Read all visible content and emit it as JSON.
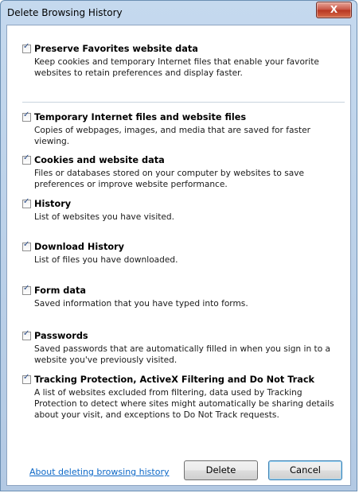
{
  "window": {
    "title": "Delete Browsing History",
    "close_label": "X"
  },
  "options": [
    {
      "title": "Preserve Favorites website data",
      "checked": true,
      "description": "Keep cookies and temporary Internet files that enable your favorite websites to retain preferences and display faster."
    },
    {
      "title": "Temporary Internet files and website files",
      "checked": true,
      "description": "Copies of webpages, images, and media that are saved for faster viewing."
    },
    {
      "title": "Cookies and website data",
      "checked": true,
      "description": "Files or databases stored on your computer by websites to save preferences or improve website performance."
    },
    {
      "title": "History",
      "checked": true,
      "description": "List of websites you have visited."
    },
    {
      "title": "Download History",
      "checked": true,
      "description": "List of files you have downloaded."
    },
    {
      "title": "Form data",
      "checked": true,
      "description": "Saved information that you have typed into forms."
    },
    {
      "title": "Passwords",
      "checked": true,
      "description": "Saved passwords that are automatically filled in when you sign in to a website you've previously visited."
    },
    {
      "title": "Tracking Protection, ActiveX Filtering and Do Not Track",
      "checked": true,
      "description": "A list of websites excluded from filtering, data used by Tracking Protection to detect where sites might automatically be sharing details about your visit, and exceptions to Do Not Track requests."
    }
  ],
  "footer": {
    "link_label": "About deleting browsing history",
    "delete_label": "Delete",
    "cancel_label": "Cancel"
  },
  "icons": {
    "checkmark": "✓"
  }
}
